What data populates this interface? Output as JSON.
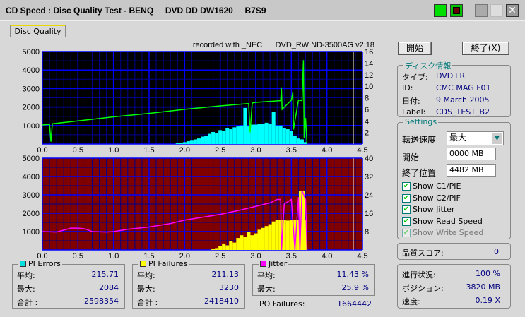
{
  "window": {
    "title": "CD Speed : Disc Quality Test - BENQ     DVD DD DW1620     B7S9"
  },
  "tab": {
    "label": "Disc Quality"
  },
  "header": {
    "recorded_with": "recorded with _NEC      DVD_RW ND-3500AG v2.18"
  },
  "buttons": {
    "start": "開始",
    "exit": "終了(X)"
  },
  "disc_info": {
    "legend": "ディスク情報",
    "rows": [
      {
        "label": "タイプ:",
        "value": "DVD+R"
      },
      {
        "label": "ID:",
        "value": "CMC MAG F01"
      },
      {
        "label": "日付:",
        "value": "9 March 2005"
      },
      {
        "label": "Label:",
        "value": "CDS_TEST_B2"
      }
    ]
  },
  "settings": {
    "legend": "Settings",
    "speed_label": "転送速度",
    "speed_value": "最大",
    "start_label": "開始",
    "start_value": "0000 MB",
    "end_label": "終了位置",
    "end_value": "4482 MB",
    "checks": [
      {
        "label": "Show C1/PIE",
        "checked": true,
        "enabled": true
      },
      {
        "label": "Show C2/PIF",
        "checked": true,
        "enabled": true
      },
      {
        "label": "Show Jitter",
        "checked": true,
        "enabled": true
      },
      {
        "label": "Show Read Speed",
        "checked": true,
        "enabled": true
      },
      {
        "label": "Show Write Speed",
        "checked": true,
        "enabled": false
      }
    ]
  },
  "quality": {
    "label": "品質スコア:",
    "value": "0"
  },
  "progress": {
    "rows": [
      {
        "label": "進行状況:",
        "value": "100 %"
      },
      {
        "label": "ポジション:",
        "value": "3820 MB"
      },
      {
        "label": "速度:",
        "value": "0.19 X"
      }
    ]
  },
  "pi_errors": {
    "legend": "PI Errors",
    "color": "#00e0e0",
    "rows": [
      {
        "label": "平均:",
        "value": "215.71"
      },
      {
        "label": "最大:",
        "value": "2084"
      },
      {
        "label": "合計 :",
        "value": "2598354"
      }
    ]
  },
  "pi_failures": {
    "legend": "PI Failures",
    "color": "#ffff00",
    "rows": [
      {
        "label": "平均:",
        "value": "211.13"
      },
      {
        "label": "最大:",
        "value": "3230"
      },
      {
        "label": "合計 :",
        "value": "2418410"
      }
    ]
  },
  "jitter": {
    "legend": "Jitter",
    "color": "#ff00ff",
    "rows": [
      {
        "label": "平均:",
        "value": "11.43 %"
      },
      {
        "label": "最大:",
        "value": "25.9 %"
      }
    ]
  },
  "po_failures": {
    "label": "PO Failures:",
    "value": "1664442"
  },
  "chart_data": [
    {
      "type": "bar",
      "name": "PI Errors / Read Speed",
      "background": "#000000",
      "xlim": [
        0,
        4.5
      ],
      "ylim": [
        0,
        5000
      ],
      "y2lim": [
        0,
        16
      ],
      "xticks": [
        "0.0",
        "0.5",
        "1.0",
        "1.5",
        "2.0",
        "2.5",
        "3.0",
        "3.5",
        "4.0",
        "4.5"
      ],
      "yticks": [
        "5000",
        "4000",
        "3000",
        "2000",
        "1000"
      ],
      "y2ticks": [
        "16",
        "14",
        "12",
        "10",
        "8",
        "6",
        "4",
        "2"
      ],
      "bars": {
        "color": "#00ffff",
        "x": [
          1.9,
          1.95,
          2.0,
          2.05,
          2.1,
          2.15,
          2.2,
          2.25,
          2.3,
          2.35,
          2.4,
          2.45,
          2.5,
          2.55,
          2.6,
          2.65,
          2.7,
          2.75,
          2.8,
          2.85,
          2.9,
          2.95,
          3.0,
          3.05,
          3.1,
          3.15,
          3.2,
          3.25,
          3.3,
          3.35,
          3.4,
          3.45,
          3.5,
          3.55,
          3.6,
          3.65,
          3.7
        ],
        "y": [
          40,
          60,
          100,
          150,
          180,
          250,
          300,
          400,
          450,
          550,
          650,
          600,
          750,
          700,
          850,
          800,
          900,
          950,
          1000,
          1950,
          950,
          1050,
          1050,
          1100,
          1100,
          1150,
          1100,
          1750,
          1000,
          1000,
          850,
          800,
          700,
          450,
          300,
          250,
          100
        ]
      },
      "line": {
        "color": "#00ff00",
        "x": [
          0,
          0.1,
          0.12,
          0.14,
          0.5,
          1.0,
          1.5,
          2.0,
          2.5,
          2.9,
          2.92,
          2.95,
          3.0,
          3.35,
          3.36,
          3.37,
          3.5,
          3.52,
          3.53,
          3.6,
          3.65,
          3.67,
          3.68,
          3.7,
          3.72
        ],
        "y": [
          3.3,
          3.4,
          0.4,
          3.5,
          4.0,
          4.7,
          5.3,
          6.0,
          6.6,
          7.0,
          2.0,
          7.1,
          7.2,
          7.5,
          9.8,
          6.0,
          7.6,
          8.9,
          2.5,
          7.6,
          7.5,
          14.5,
          1.0,
          4.5,
          0
        ]
      }
    },
    {
      "type": "bar",
      "name": "PI Failures / Jitter",
      "background": "#800000",
      "xlim": [
        0,
        4.5
      ],
      "ylim": [
        0,
        5000
      ],
      "y2lim": [
        0,
        40
      ],
      "xticks": [
        "0.0",
        "0.5",
        "1.0",
        "1.5",
        "2.0",
        "2.5",
        "3.0",
        "3.5",
        "4.0",
        "4.5"
      ],
      "yticks": [
        "5000",
        "4000",
        "3000",
        "2000",
        "1000"
      ],
      "y2ticks": [
        "40",
        "32",
        "24",
        "16",
        "8"
      ],
      "bars": {
        "color": "#ffff00",
        "x": [
          2.4,
          2.45,
          2.5,
          2.55,
          2.6,
          2.65,
          2.7,
          2.75,
          2.8,
          2.85,
          2.9,
          2.95,
          3.0,
          3.05,
          3.1,
          3.15,
          3.2,
          3.25,
          3.3,
          3.35,
          3.4,
          3.45,
          3.5,
          3.55,
          3.6,
          3.63,
          3.65,
          3.67,
          3.7
        ],
        "y": [
          50,
          100,
          200,
          350,
          250,
          500,
          400,
          650,
          800,
          700,
          1000,
          800,
          900,
          1100,
          1200,
          1300,
          1400,
          1550,
          1650,
          1650,
          1650,
          1600,
          1650,
          1650,
          1650,
          3230,
          1650,
          3230,
          1650
        ]
      },
      "line": {
        "color": "#ff00ff",
        "x": [
          0,
          0.2,
          0.4,
          0.5,
          0.6,
          0.7,
          0.9,
          1.0,
          1.2,
          1.5,
          1.8,
          2.0,
          2.3,
          2.5,
          2.8,
          3.0,
          3.2,
          3.3,
          3.35,
          3.36,
          3.4,
          3.5,
          3.55,
          3.6,
          3.62,
          3.65,
          3.7,
          3.72
        ],
        "y": [
          8,
          7.8,
          9.5,
          9.5,
          9.2,
          8,
          7.8,
          8,
          9,
          10,
          11.5,
          13,
          14.5,
          15.5,
          17.5,
          19,
          20.5,
          22,
          22,
          0,
          20,
          22,
          0,
          23,
          0,
          25.9,
          22,
          0
        ]
      }
    }
  ]
}
